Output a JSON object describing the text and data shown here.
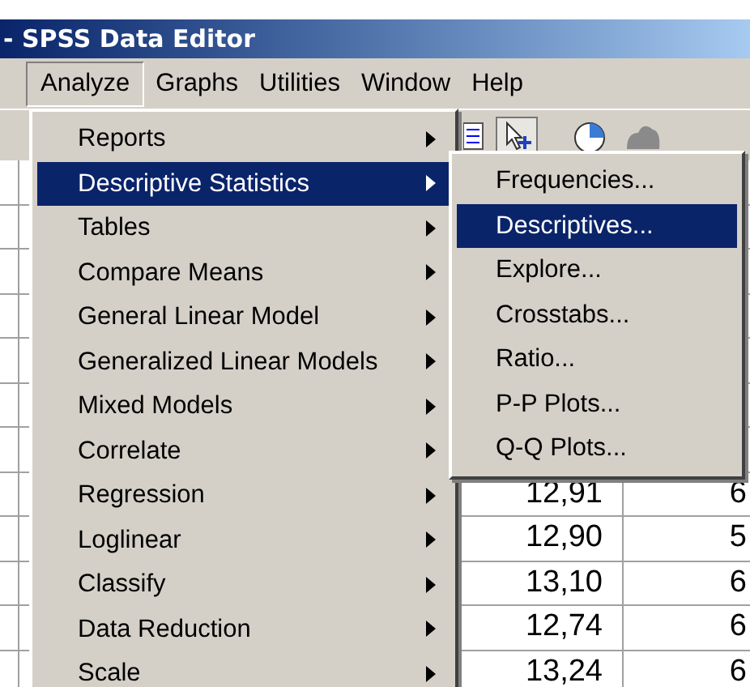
{
  "window": {
    "title": "- SPSS Data Editor"
  },
  "menu_bar": [
    {
      "label": "Analyze",
      "selected": true
    },
    {
      "label": "Graphs",
      "selected": false
    },
    {
      "label": "Utilities",
      "selected": false
    },
    {
      "label": "Window",
      "selected": false
    },
    {
      "label": "Help",
      "selected": false
    }
  ],
  "analyze_menu": [
    {
      "label": "Reports",
      "selected": false,
      "has_submenu": true
    },
    {
      "label": "Descriptive Statistics",
      "selected": true,
      "has_submenu": true
    },
    {
      "label": "Tables",
      "selected": false,
      "has_submenu": true
    },
    {
      "label": "Compare Means",
      "selected": false,
      "has_submenu": true
    },
    {
      "label": "General Linear Model",
      "selected": false,
      "has_submenu": true
    },
    {
      "label": "Generalized Linear Models",
      "selected": false,
      "has_submenu": true
    },
    {
      "label": "Mixed Models",
      "selected": false,
      "has_submenu": true
    },
    {
      "label": "Correlate",
      "selected": false,
      "has_submenu": true
    },
    {
      "label": "Regression",
      "selected": false,
      "has_submenu": true
    },
    {
      "label": "Loglinear",
      "selected": false,
      "has_submenu": true
    },
    {
      "label": "Classify",
      "selected": false,
      "has_submenu": true
    },
    {
      "label": "Data Reduction",
      "selected": false,
      "has_submenu": true
    },
    {
      "label": "Scale",
      "selected": false,
      "has_submenu": true
    }
  ],
  "submenu": [
    {
      "label": "Frequencies...",
      "selected": false
    },
    {
      "label": "Descriptives...",
      "selected": true
    },
    {
      "label": "Explore...",
      "selected": false
    },
    {
      "label": "Crosstabs...",
      "selected": false
    },
    {
      "label": "Ratio...",
      "selected": false
    },
    {
      "label": "P-P Plots...",
      "selected": false
    },
    {
      "label": "Q-Q Plots...",
      "selected": false
    }
  ],
  "data_rows": [
    {
      "column_1": "12,91",
      "column_2": "6"
    },
    {
      "column_1": "12,90",
      "column_2": "5"
    },
    {
      "column_1": "13,10",
      "column_2": "6"
    },
    {
      "column_1": "12,74",
      "column_2": "6"
    },
    {
      "column_1": "13,24",
      "column_2": "6"
    }
  ]
}
